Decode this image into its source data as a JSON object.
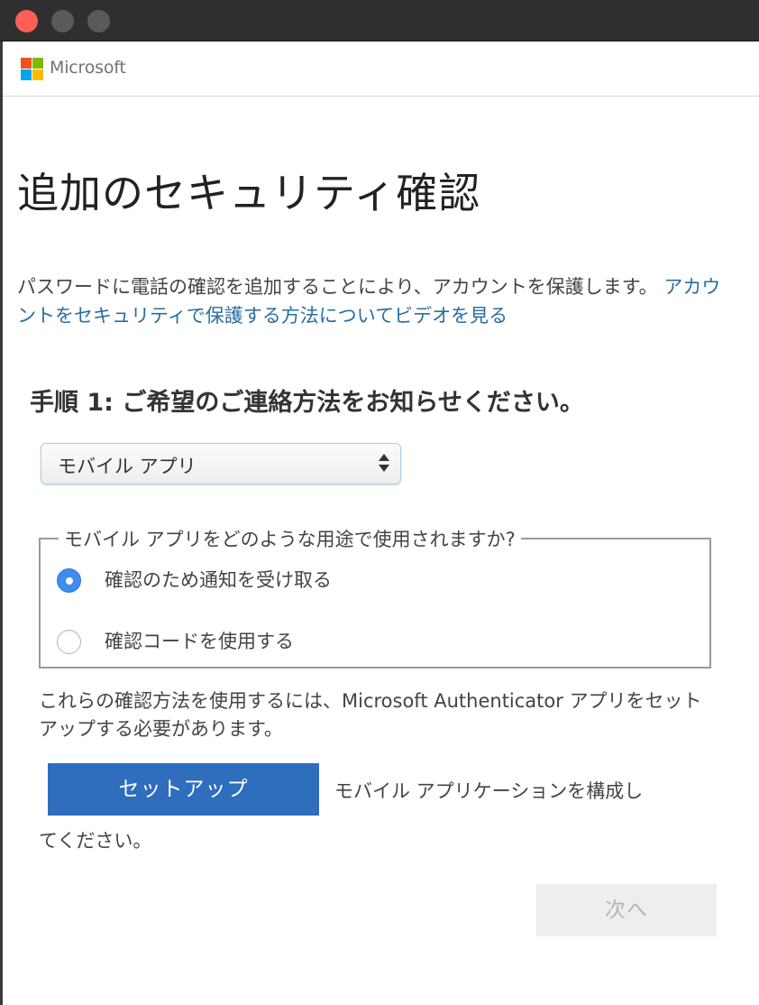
{
  "brand": {
    "name": "Microsoft",
    "logo_colors": [
      "#f25022",
      "#7fba00",
      "#00a4ef",
      "#ffb900"
    ]
  },
  "page": {
    "title": "追加のセキュリティ確認",
    "intro_text": "パスワードに電話の確認を追加することにより、アカウントを保護します。",
    "intro_link": "アカウントをセキュリティで保護する方法についてビデオを見る"
  },
  "step": {
    "title": "手順 1: ご希望のご連絡方法をお知らせください。",
    "method_select": {
      "selected": "モバイル アプリ"
    }
  },
  "usage": {
    "legend": "モバイル アプリをどのような用途で使用されますか?",
    "options": [
      {
        "label": "確認のため通知を受け取る",
        "selected": true
      },
      {
        "label": "確認コードを使用する",
        "selected": false
      }
    ]
  },
  "authenticator_note": "これらの確認方法を使用するには、Microsoft Authenticator アプリをセットアップする必要があります。",
  "setup": {
    "button_label": "セットアップ",
    "text_line1": "モバイル アプリケーションを構成し",
    "text_line2": "てください。"
  },
  "next_button": {
    "label": "次へ",
    "enabled": false
  },
  "colors": {
    "primary_button": "#2f6dbd",
    "link": "#2a6e9e",
    "radio_selected": "#3f8cf0",
    "disabled_button_bg": "#eeeeee"
  }
}
